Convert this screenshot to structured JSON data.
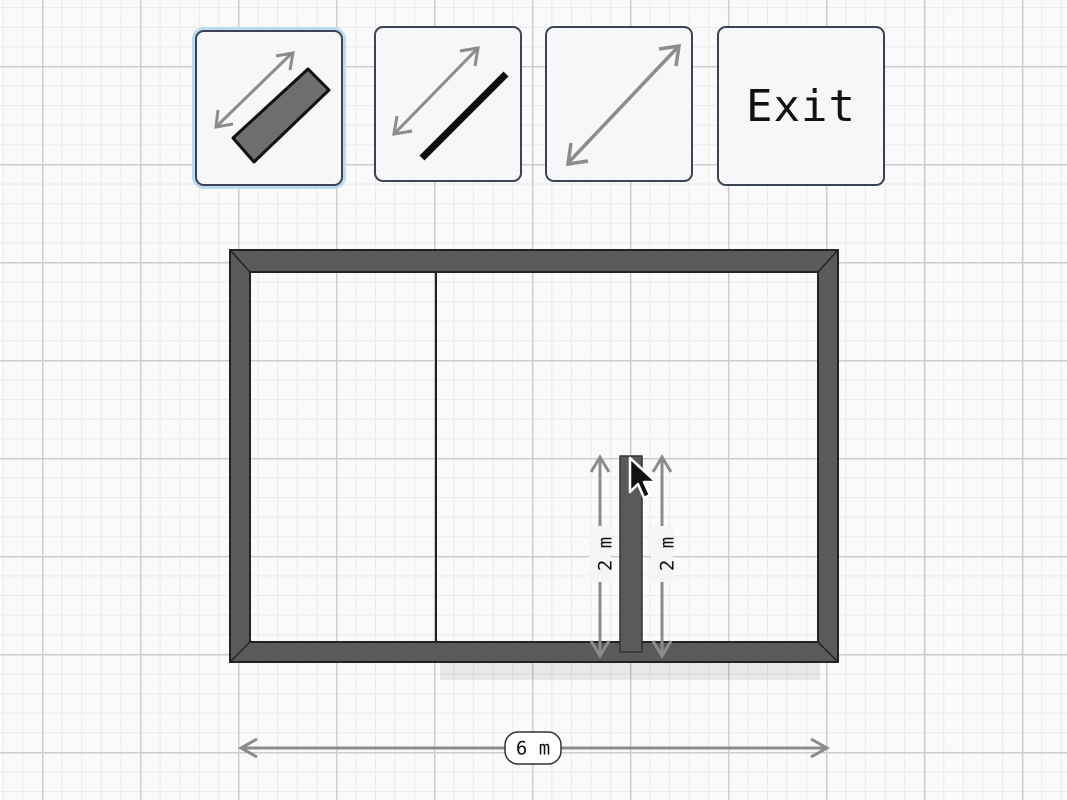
{
  "toolbar": {
    "tools": [
      {
        "name": "wall-tool",
        "selected": true,
        "icon": "wall-thick-icon"
      },
      {
        "name": "line-tool",
        "selected": false,
        "icon": "wall-thin-icon"
      },
      {
        "name": "dimension-tool",
        "selected": false,
        "icon": "dimension-arrow-icon"
      }
    ],
    "exit_label": "Exit"
  },
  "dimensions": {
    "bottom_width": "6 m",
    "left_wall_length": "2 m",
    "right_wall_length": "2 m"
  },
  "colors": {
    "wall": "#5a5a5a",
    "dimension": "#8c8c8c",
    "button_border": "#3b4453",
    "selected_glow": "#b9dcf5"
  }
}
